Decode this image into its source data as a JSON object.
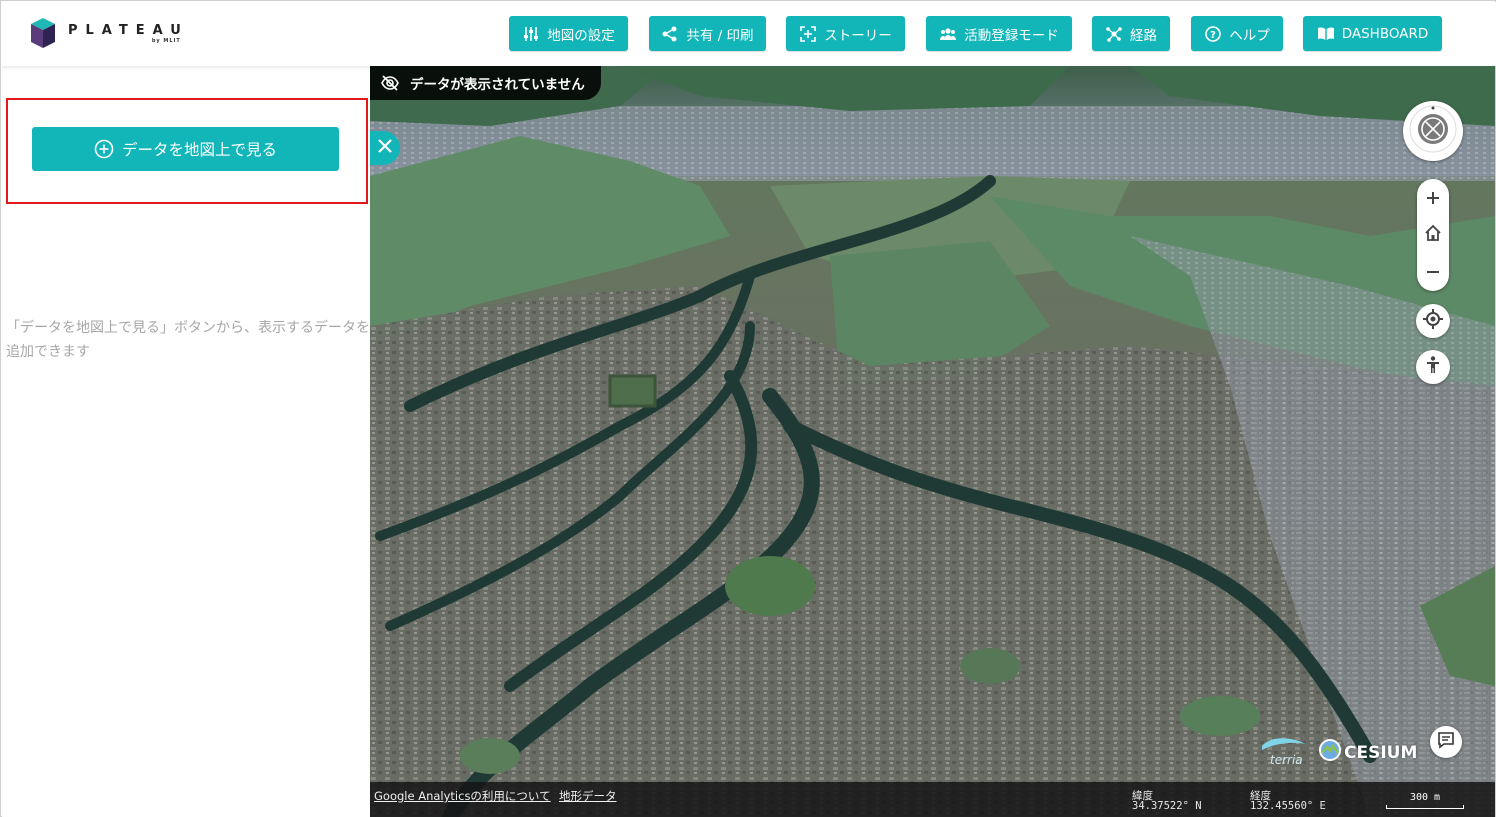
{
  "app": {
    "logo_title": "PLATEAU",
    "logo_sub": "by MLIT"
  },
  "header": {
    "nav": [
      {
        "label": "地図の設定",
        "icon": "sliders-icon"
      },
      {
        "label": "共有 / 印刷",
        "icon": "share-icon"
      },
      {
        "label": "ストーリー",
        "icon": "story-icon"
      },
      {
        "label": "活動登録モード",
        "icon": "people-icon"
      },
      {
        "label": "経路",
        "icon": "route-icon"
      },
      {
        "label": "ヘルプ",
        "icon": "help-icon"
      },
      {
        "label": "DASHBOARD",
        "icon": "book-icon"
      }
    ]
  },
  "left_panel": {
    "add_data_label": "データを地図上で見る",
    "hint": "「データを地図上で見る」ボタンから、表示するデータを追加できます"
  },
  "map": {
    "no_data_label": "データが表示されていません",
    "google_analytics_link": "Google Analyticsの利用について",
    "terrain_link": "地形データ",
    "lat_label": "緯度",
    "lat_value": "34.37522° N",
    "lon_label": "経度",
    "lon_value": "132.45560° E",
    "scale_label": "300 m",
    "cesium_label": "CESIUM",
    "terria_label": "terria"
  },
  "colors": {
    "accent": "#12b5b8",
    "highlight": "#e3181f"
  }
}
